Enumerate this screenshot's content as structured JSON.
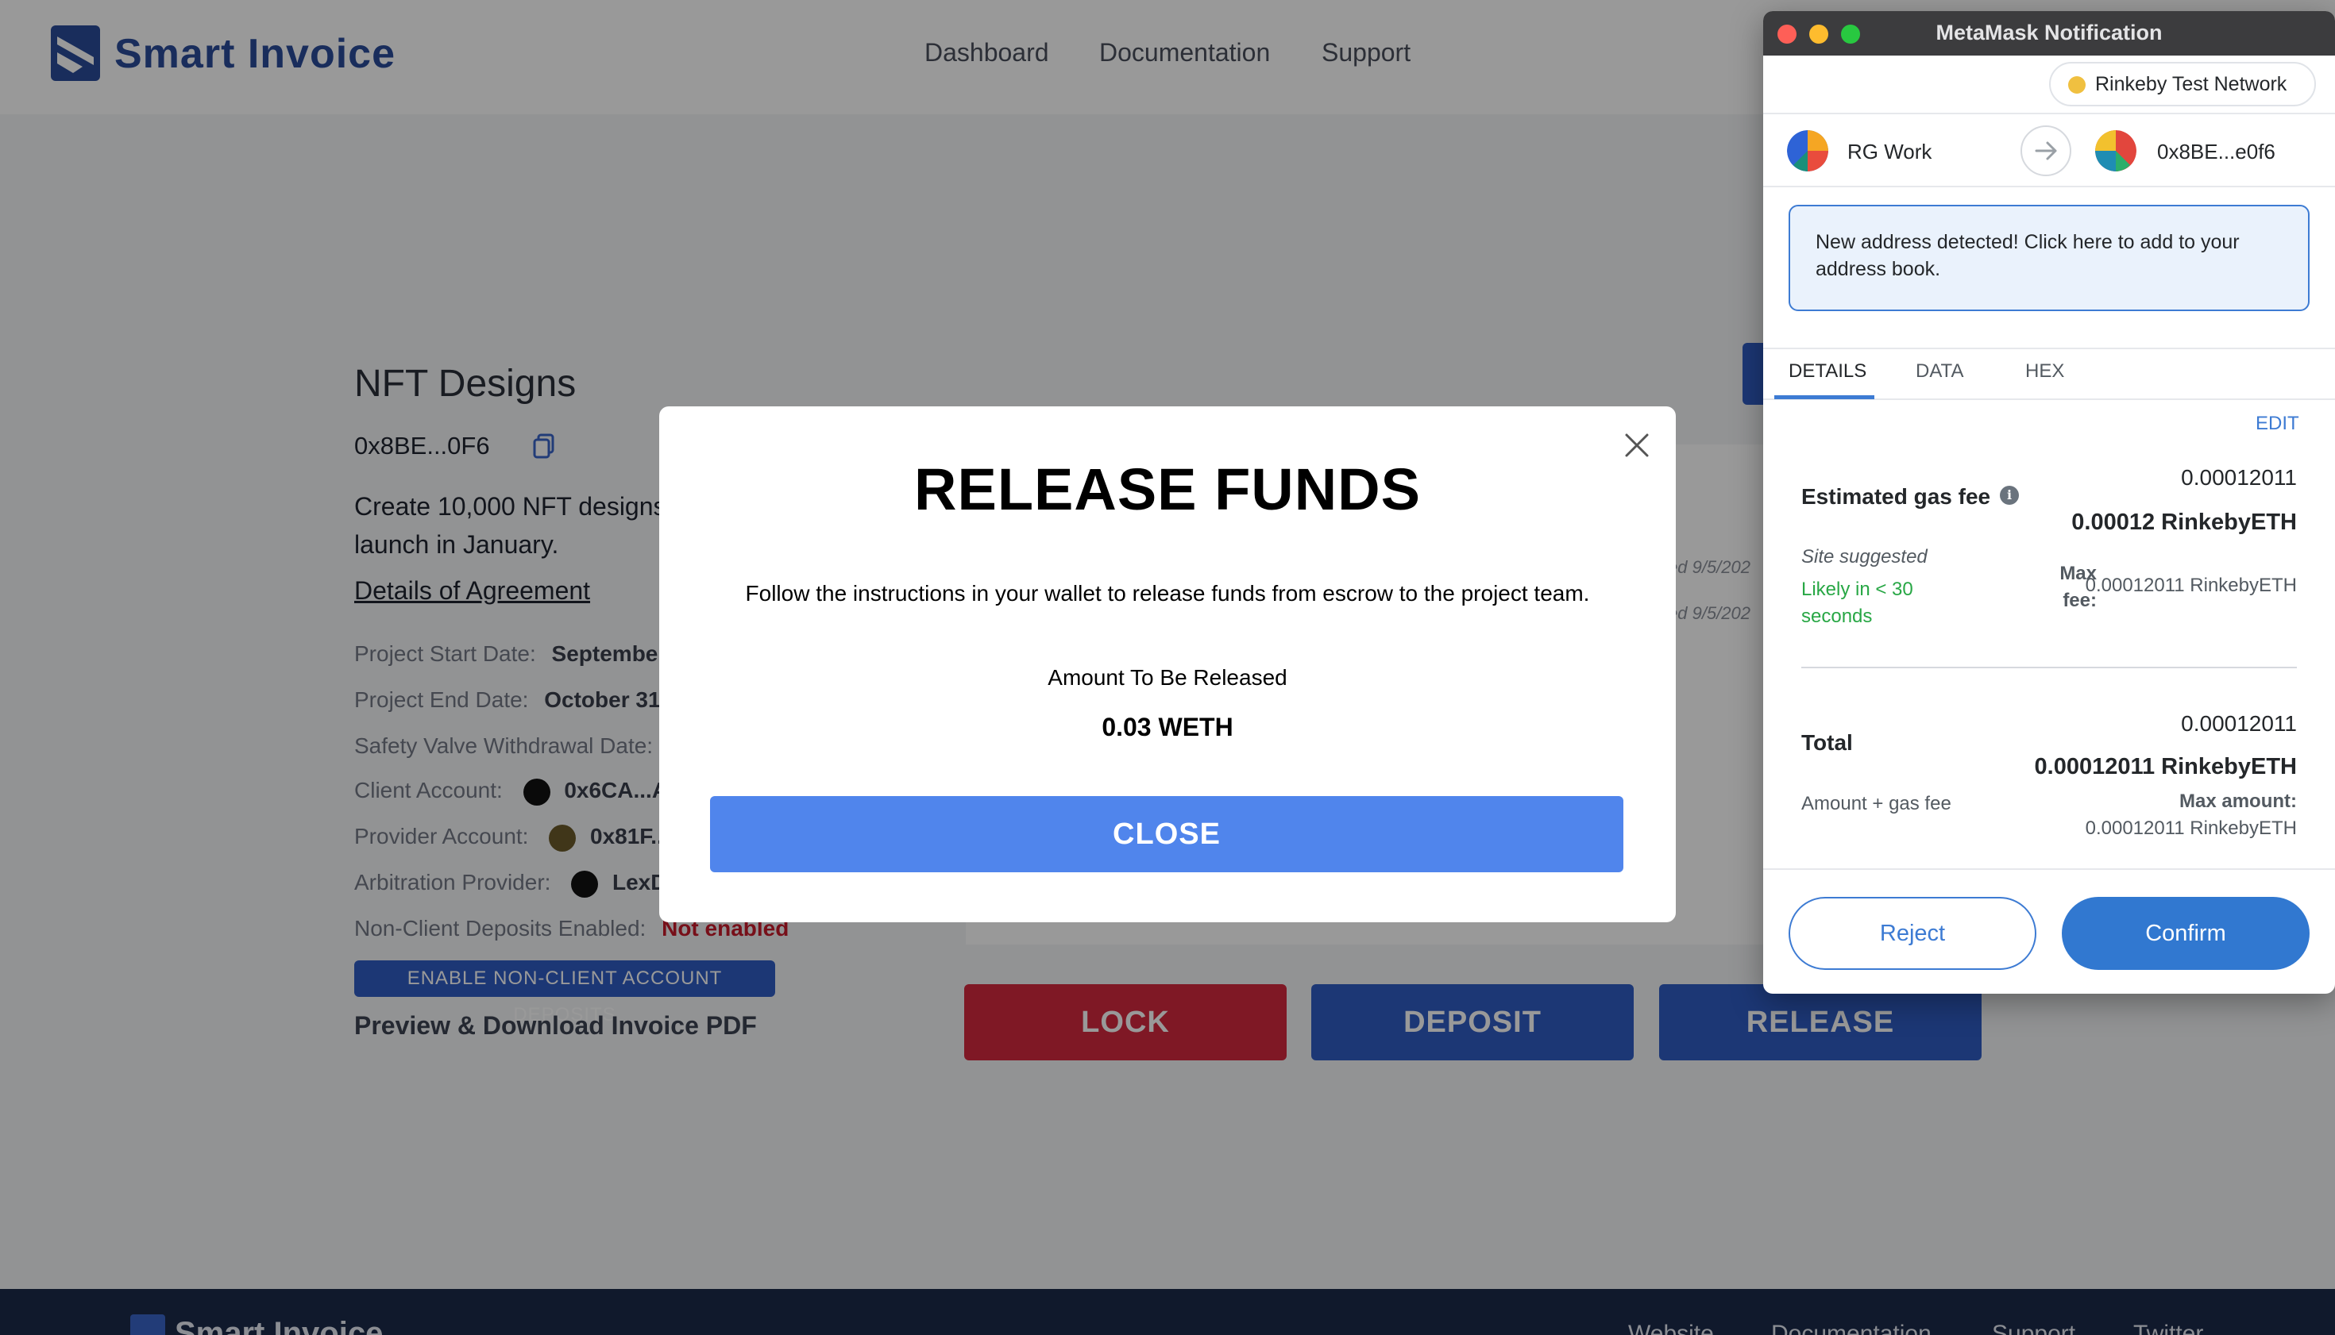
{
  "header": {
    "brand": "Smart Invoice",
    "nav": [
      "Dashboard",
      "Documentation",
      "Support"
    ]
  },
  "invoice": {
    "title": "NFT Designs",
    "address": "0x8BE...0F6",
    "description": "Create 10,000 NFT designs launch in January.",
    "agreement_link": "Details of Agreement",
    "rows": {
      "start_label": "Project Start Date:",
      "start_value": "September",
      "end_label": "Project End Date:",
      "end_value": "October 31",
      "safety_label": "Safety Valve Withdrawal Date:",
      "client_label": "Client Account:",
      "client_value": "0x6CA...A",
      "provider_label": "Provider Account:",
      "provider_value": "0x81F...",
      "arbitration_label": "Arbitration Provider:",
      "arbitration_value": "LexD",
      "nonclient_label": "Non-Client Deposits Enabled:",
      "nonclient_value": "Not enabled"
    },
    "enable_button": "ENABLE NON-CLIENT ACCOUNT DEPOSITS",
    "preview_link": "Preview & Download Invoice PDF",
    "dated_1": "ed 9/5/202",
    "dated_2": "ed 9/5/202",
    "actions": {
      "lock": "LOCK",
      "deposit": "DEPOSIT",
      "release": "RELEASE"
    }
  },
  "footer": {
    "brand": "Smart Invoice",
    "links": [
      "Website",
      "Documentation",
      "Support",
      "Twitter"
    ]
  },
  "modal": {
    "title": "RELEASE FUNDS",
    "text": "Follow the instructions in your wallet to release funds from escrow to the project team.",
    "amount_label": "Amount To Be Released",
    "amount": "0.03 WETH",
    "close_button": "CLOSE"
  },
  "metamask": {
    "window_title": "MetaMask Notification",
    "network": "Rinkeby Test Network",
    "from_account": "RG Work",
    "to_account": "0x8BE...e0f6",
    "alert": "New address detected! Click here to add to your address book.",
    "tabs": [
      "DETAILS",
      "DATA",
      "HEX"
    ],
    "edit": "EDIT",
    "gas": {
      "label": "Estimated gas fee",
      "value_top": "0.00012011",
      "value_bold": "0.00012 RinkebyETH",
      "site_suggested": "Site suggested",
      "likely": "Likely in < 30 seconds",
      "max_fee_label": "Max fee:",
      "max_fee_value": "0.00012011 RinkebyETH"
    },
    "total": {
      "label": "Total",
      "value_top": "0.00012011",
      "value_bold": "0.00012011 RinkebyETH",
      "amount_gas": "Amount + gas fee",
      "max_amount_label": "Max amount:",
      "max_amount_value": "0.00012011 RinkebyETH"
    },
    "reject": "Reject",
    "confirm": "Confirm"
  },
  "colors": {
    "brand_blue": "#2f5cc4",
    "lock_red": "#d4283e",
    "modal_button": "#5085ec",
    "metamask_blue": "#3178d0",
    "success_green": "#28a745",
    "error_red": "#c61a2b"
  }
}
